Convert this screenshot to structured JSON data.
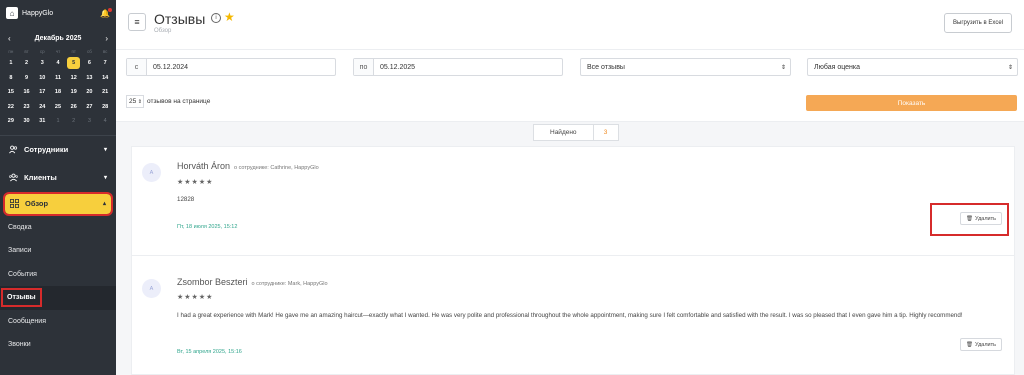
{
  "app": {
    "name": "HappyGlo"
  },
  "calendar": {
    "month_label": "Декабрь 2025",
    "weekdays": [
      "пн",
      "вт",
      "ср",
      "чт",
      "пт",
      "сб",
      "вс"
    ],
    "weeks": [
      [
        "1",
        "2",
        "3",
        "4",
        "5",
        "6",
        "7"
      ],
      [
        "8",
        "9",
        "10",
        "11",
        "12",
        "13",
        "14"
      ],
      [
        "15",
        "16",
        "17",
        "18",
        "19",
        "20",
        "21"
      ],
      [
        "22",
        "23",
        "24",
        "25",
        "26",
        "27",
        "28"
      ],
      [
        "29",
        "30",
        "31",
        "1",
        "2",
        "3",
        "4"
      ]
    ],
    "today": "5"
  },
  "sidebar": {
    "employees": "Сотрудники",
    "clients": "Клиенты",
    "overview": "Обзор",
    "sub_items": [
      "Сводка",
      "Записи",
      "События",
      "Отзывы",
      "Сообщения",
      "Звонки"
    ],
    "active_sub": "Отзывы"
  },
  "header": {
    "title": "Отзывы",
    "breadcrumb": "Обзор",
    "export_label": "Выгрузить в Excel"
  },
  "filters": {
    "from_prefix": "с",
    "from_value": "05.12.2024",
    "to_prefix": "по",
    "to_value": "05.12.2025",
    "review_type": "Все отзывы",
    "rating": "Любая оценка",
    "per_page_value": "25",
    "per_page_label": "отзывов на странице",
    "show_label": "Показать"
  },
  "found": {
    "label": "Найдено",
    "count": "3"
  },
  "reviews": [
    {
      "avatar": "A",
      "name": "Horváth Áron",
      "employee": "о сотруднике: Cathrine, HappyGlo",
      "stars": "★★★★★",
      "text": "12828",
      "date": "Пт, 18 июля 2025, 15:12",
      "delete_label": "Удалить"
    },
    {
      "avatar": "A",
      "name": "Zsombor Beszteri",
      "employee": "о сотруднике: Mark, HappyGlo",
      "stars": "★★★★★",
      "text": "I had a great experience with Mark! He gave me an amazing haircut—exactly what I wanted. He was very polite and professional throughout the whole appointment, making sure I felt comfortable and satisfied with the result. I was so pleased that I even gave him a tip. Highly recommend!",
      "date": "Вт, 15 апреля 2025, 15:16",
      "delete_label": "Удалить"
    }
  ]
}
